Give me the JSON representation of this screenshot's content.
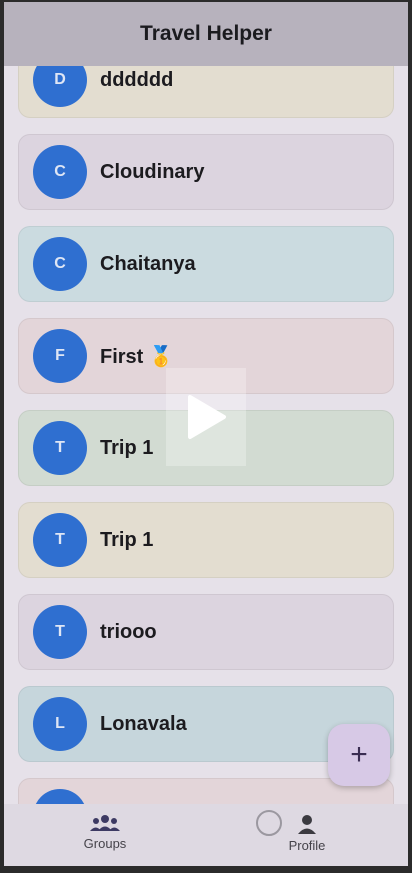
{
  "app": {
    "title": "Travel Helper"
  },
  "groups": [
    {
      "initial": "D",
      "name": "dddddd",
      "color": "#e3ddd0"
    },
    {
      "initial": "C",
      "name": "Cloudinary",
      "color": "#dcd4df"
    },
    {
      "initial": "C",
      "name": "Chaitanya",
      "color": "#cbdbe0"
    },
    {
      "initial": "F",
      "name": "First 🥇",
      "color": "#e3d5d9"
    },
    {
      "initial": "T",
      "name": "Trip 1",
      "color": "#d2dbd2"
    },
    {
      "initial": "T",
      "name": "Trip 1",
      "color": "#e3ddd0"
    },
    {
      "initial": "T",
      "name": "triooo",
      "color": "#dcd4df"
    },
    {
      "initial": "L",
      "name": "Lonavala",
      "color": "#c6d6dc"
    },
    {
      "initial": "",
      "name": "",
      "color": "#e3d5d9"
    }
  ],
  "fab": {
    "label": "+"
  },
  "nav": {
    "groups_label": "Groups",
    "profile_label": "Profile"
  },
  "colors": {
    "accent": "#2f6fd0",
    "appbar": "#b7b2bd",
    "fab": "#d7c9e6"
  }
}
